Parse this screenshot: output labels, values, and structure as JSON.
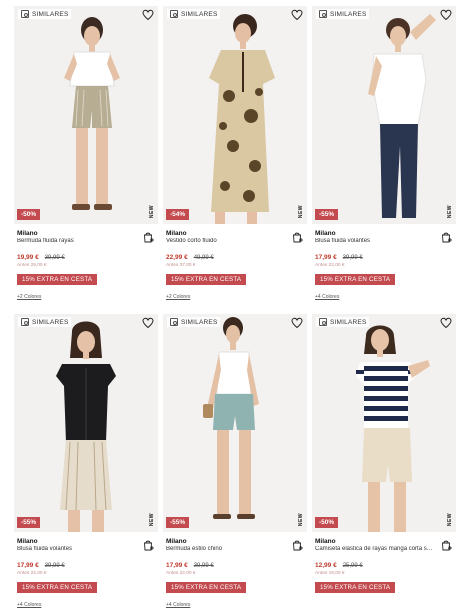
{
  "labels": {
    "similar": "SIMILARES",
    "extra": "15% EXTRA EN CESTA",
    "new": "NEW"
  },
  "colors": {
    "discount_bg": "#c34a4e",
    "price": "#c0392b"
  },
  "products": [
    {
      "brand": "Milano",
      "name": "Bermuda fluida rayas",
      "discount": "-50%",
      "price": "19,99 €",
      "old_price": "39,99 €",
      "before": "Antes 29,00 €",
      "colors": "+2 Colores"
    },
    {
      "brand": "Milano",
      "name": "Vestido corto fluido",
      "discount": "-54%",
      "price": "22,99 €",
      "old_price": "49,99 €",
      "before": "Antes 37,00 €",
      "colors": "+2 Colores"
    },
    {
      "brand": "Milano",
      "name": "Blusa fluida volantes",
      "discount": "-55%",
      "price": "17,99 €",
      "old_price": "39,99 €",
      "before": "Antes 22,00 €",
      "colors": "+4 Colores"
    },
    {
      "brand": "Milano",
      "name": "Blusa fluida volantes",
      "discount": "-55%",
      "price": "17,99 €",
      "old_price": "39,99 €",
      "before": "Antes 22,00 €",
      "colors": "+4 Colores"
    },
    {
      "brand": "Milano",
      "name": "Bermuda estilo chino",
      "discount": "-55%",
      "price": "17,99 €",
      "old_price": "39,99 €",
      "before": "Antes 22,00 €",
      "colors": "+4 Colores"
    },
    {
      "brand": "Milano",
      "name": "Camiseta elástica de rayas manga corta soft...",
      "discount": "-50%",
      "price": "12,99 €",
      "old_price": "25,99 €",
      "before": "Antes 19,00 €",
      "colors": ""
    }
  ]
}
